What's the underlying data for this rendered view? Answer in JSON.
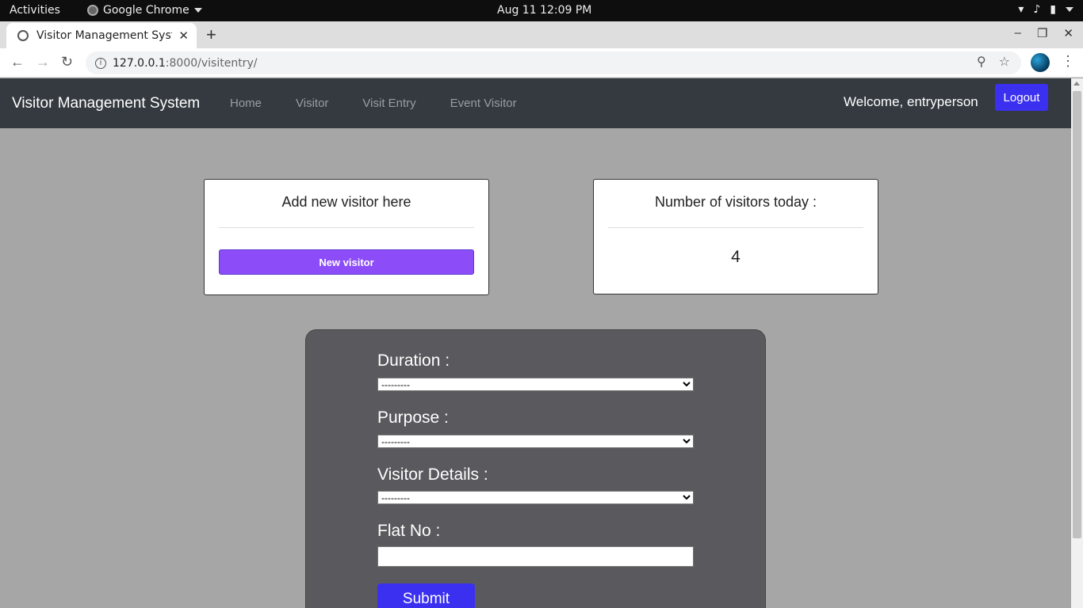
{
  "os_bar": {
    "activities": "Activities",
    "app_name": "Google Chrome",
    "datetime": "Aug 11  12:09 PM"
  },
  "browser": {
    "tab_title": "Visitor Management System",
    "url_host": "127.0.0.1",
    "url_path": ":8000/visitentry/"
  },
  "navbar": {
    "brand": "Visitor Management System",
    "links": [
      "Home",
      "Visitor",
      "Visit Entry",
      "Event Visitor"
    ],
    "welcome": "Welcome, entryperson",
    "logout": "Logout"
  },
  "cards": {
    "add_heading": "Add new visitor here",
    "add_button": "New visitor",
    "count_heading": "Number of visitors today :",
    "count_value": "4"
  },
  "form": {
    "duration_label": "Duration :",
    "duration_value": "---------",
    "purpose_label": "Purpose :",
    "purpose_value": "---------",
    "visitor_label": "Visitor Details :",
    "visitor_value": "---------",
    "flat_label": "Flat No :",
    "flat_value": "",
    "submit": "Submit"
  },
  "colors": {
    "navbar_bg": "#343a40",
    "accent_blue": "#3b30f0",
    "accent_purple": "#8c4cf8",
    "page_bg": "#a6a6a6",
    "form_bg": "#5a5a5e"
  }
}
